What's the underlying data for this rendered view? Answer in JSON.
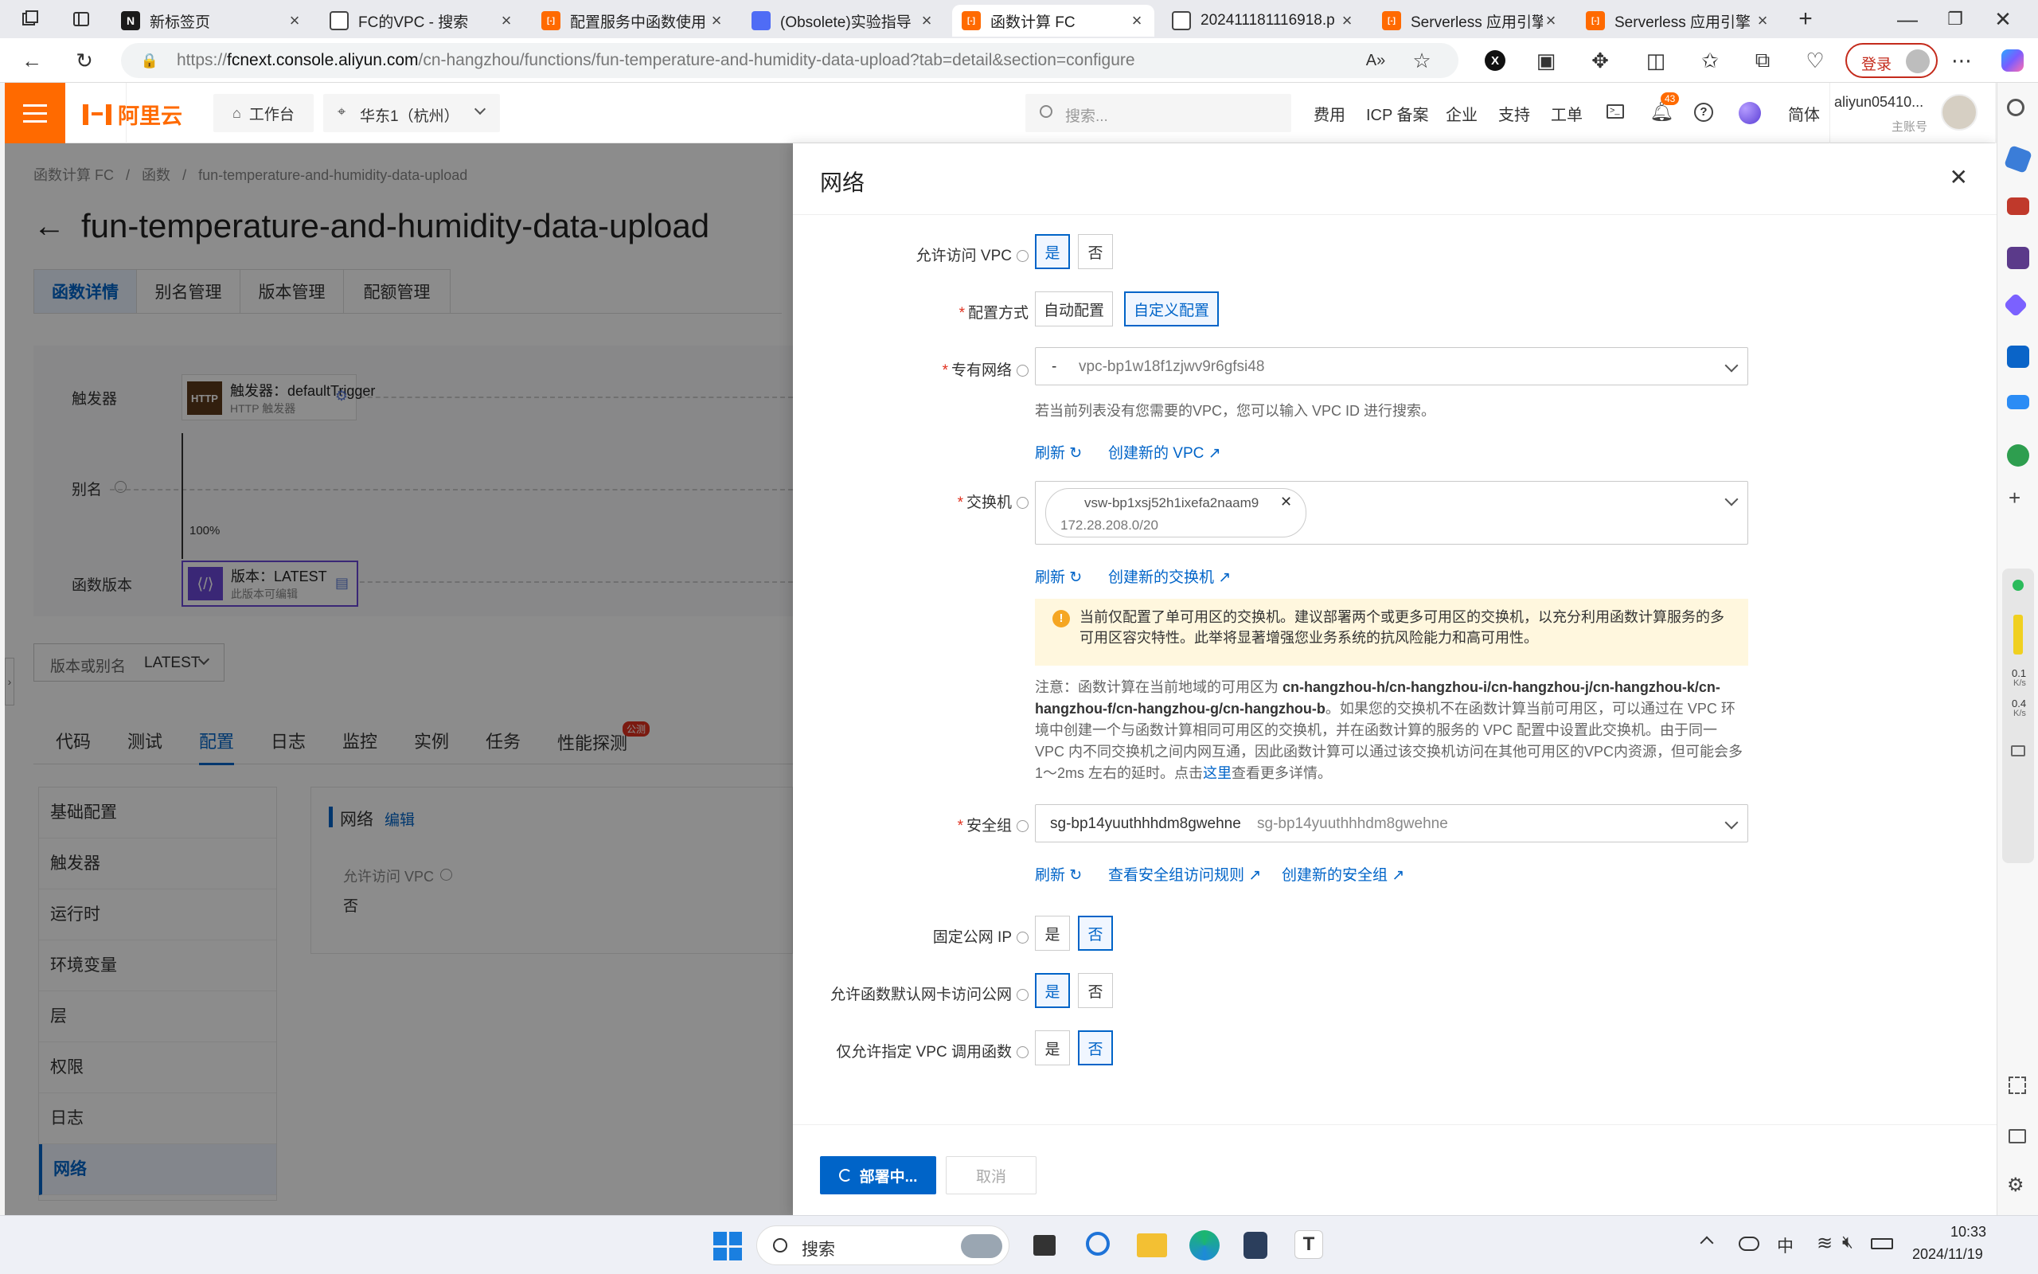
{
  "browser": {
    "tabs": [
      {
        "title": "新标签页",
        "color": "#1a1a1a",
        "glyph": "N"
      },
      {
        "title": "FC的VPC - 搜索",
        "color": "#ffffff",
        "glyph": "search-icon"
      },
      {
        "title": "配置服务中函数使用",
        "color": "#ff6a00",
        "glyph": "aliyun-icon"
      },
      {
        "title": "(Obsolete)实验指导",
        "color": "#4f6cf5",
        "glyph": "doc-icon"
      },
      {
        "title": "函数计算 FC",
        "color": "#ff6a00",
        "glyph": "aliyun-icon"
      },
      {
        "title": "202411181116918.p",
        "color": "#ffffff",
        "glyph": "file-icon"
      },
      {
        "title": "Serverless 应用引擎",
        "color": "#ff6a00",
        "glyph": "aliyun-icon"
      },
      {
        "title": "Serverless 应用引擎",
        "color": "#ff6a00",
        "glyph": "aliyun-icon"
      }
    ],
    "url": "https://fcnext.console.aliyun.com/cn-hangzhou/functions/fun-temperature-and-humidity-data-upload?tab=detail&section=configure",
    "url_host": "fcnext.console.aliyun.com",
    "login_label": "登录"
  },
  "topnav": {
    "logo": "阿里云",
    "workbench": "工作台",
    "region": "华东1（杭州）",
    "search_placeholder": "搜索...",
    "links": [
      "费用",
      "ICP 备案",
      "企业",
      "支持",
      "工单"
    ],
    "notif_count": "43",
    "lang": "简体",
    "user": "aliyun05410...",
    "user_role": "主账号"
  },
  "page": {
    "breadcrumb": [
      "函数计算 FC",
      "函数",
      "fun-temperature-and-humidity-data-upload"
    ],
    "title": "fun-temperature-and-humidity-data-upload",
    "tabs": [
      "函数详情",
      "别名管理",
      "版本管理",
      "配额管理"
    ],
    "diagram": {
      "trigger_row": "触发器",
      "alias_row": "别名",
      "version_row": "函数版本",
      "trigger_badge": "HTTP",
      "trigger_name": "触发器：defaultTrigger",
      "trigger_type": "HTTP 触发器",
      "percent": "100%",
      "version_name": "版本：LATEST",
      "version_note": "此版本可编辑"
    },
    "version_select_label": "版本或别名",
    "version_select_value": "LATEST",
    "subtabs": [
      "代码",
      "测试",
      "配置",
      "日志",
      "监控",
      "实例",
      "任务",
      "性能探测"
    ],
    "subtab_badge": "公测",
    "config_menu": [
      "基础配置",
      "触发器",
      "运行时",
      "环境变量",
      "层",
      "权限",
      "日志",
      "网络"
    ],
    "network_card_title": "网络",
    "network_card_edit": "编辑",
    "network_card_field": "允许访问 VPC",
    "network_card_value": "否"
  },
  "drawer": {
    "title": "网络",
    "yes": "是",
    "no": "否",
    "allow_vpc_label": "允许访问 VPC",
    "config_mode_label": "配置方式",
    "config_auto": "自动配置",
    "config_custom": "自定义配置",
    "vpc_label": "专有网络",
    "vpc_prefix": "-",
    "vpc_value": "vpc-bp1w18f1zjwv9r6gfsi48",
    "vpc_hint": "若当前列表没有您需要的VPC，您可以输入 VPC ID 进行搜索。",
    "refresh": "刷新",
    "create_vpc": "创建新的 VPC",
    "vswitch_label": "交换机",
    "vswitch_id": "vsw-bp1xsj52h1ixefa2naam9",
    "vswitch_cidr": "172.28.208.0/20",
    "create_vswitch": "创建新的交换机",
    "warning": "当前仅配置了单可用区的交换机。建议部署两个或更多可用区的交换机，以充分利用函数计算服务的多可用区容灾特性。此举将显著增强您业务系统的抗风险能力和高可用性。",
    "note_prefix": "注意：函数计算在当前地域的可用区为 ",
    "note_zones": "cn-hangzhou-h/cn-hangzhou-i/cn-hangzhou-j/cn-hangzhou-k/cn-hangzhou-f/cn-hangzhou-g/cn-hangzhou-b",
    "note_body": "。如果您的交换机不在函数计算当前可用区，可以通过在 VPC 环境中创建一个与函数计算相同可用区的交换机，并在函数计算的服务的 VPC 配置中设置此交换机。由于同一 VPC 内不同交换机之间内网互通，因此函数计算可以通过该交换机访问在其他可用区的VPC内资源，但可能会多 1～2ms 左右的延时。点击",
    "note_link": "这里",
    "note_tail": "查看更多详情。",
    "sg_label": "安全组",
    "sg_value": "sg-bp14yuuthhhdm8gwehne",
    "sg_sub": "sg-bp14yuuthhhdm8gwehne",
    "view_sg_rules": "查看安全组访问规则",
    "create_sg": "创建新的安全组",
    "static_ip_label": "固定公网 IP",
    "default_nic_label": "允许函数默认网卡访问公网",
    "vpc_only_label": "仅允许指定 VPC 调用函数",
    "deploy": "部署中...",
    "cancel": "取消"
  },
  "taskbar": {
    "search": "搜索",
    "time": "10:33",
    "date": "2024/11/19",
    "ime": "中",
    "speed_up": "0.1",
    "speed_down": "0.4",
    "speed_unit": "K/s"
  }
}
